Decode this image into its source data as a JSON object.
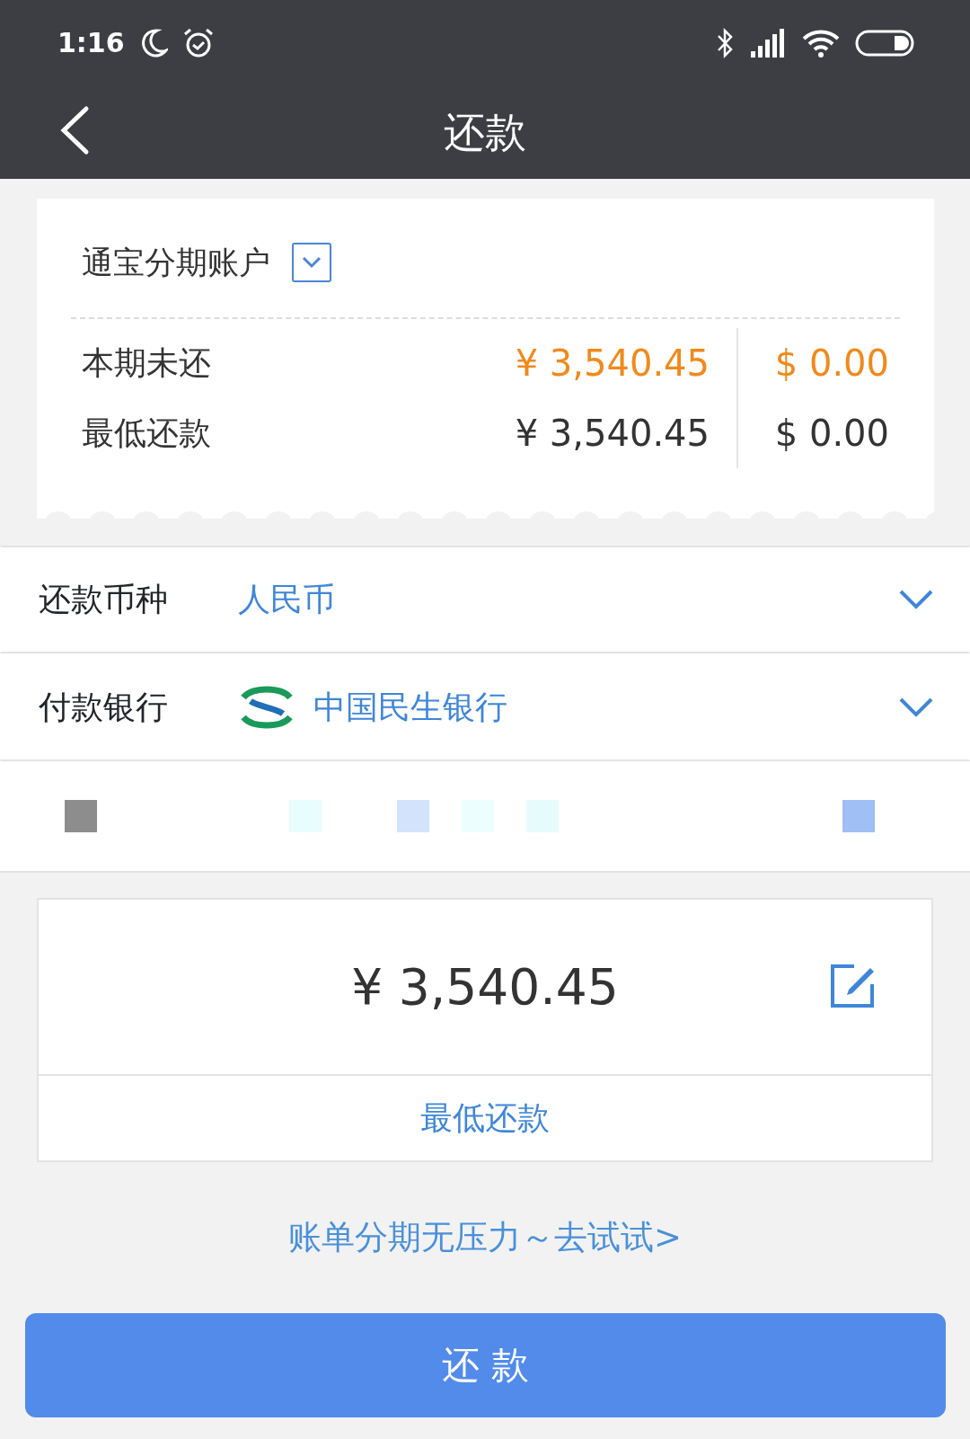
{
  "status_bar": {
    "time": "1:16"
  },
  "header": {
    "title": "还款"
  },
  "account": {
    "name": "通宝分期账户",
    "rows": [
      {
        "label": "本期未还",
        "cny": "¥ 3,540.45",
        "usd": "$ 0.00",
        "highlight": true
      },
      {
        "label": "最低还款",
        "cny": "¥ 3,540.45",
        "usd": "$ 0.00",
        "highlight": false
      }
    ]
  },
  "form": [
    {
      "label": "还款币种",
      "value": "人民币",
      "kind": "plain"
    },
    {
      "label": "付款银行",
      "value": "中国民生银行",
      "kind": "bank"
    }
  ],
  "amount": {
    "value": "¥  3,540.45",
    "option": "最低还款"
  },
  "promo_link": "账单分期无压力～去试试>",
  "submit_button": "还 款"
}
